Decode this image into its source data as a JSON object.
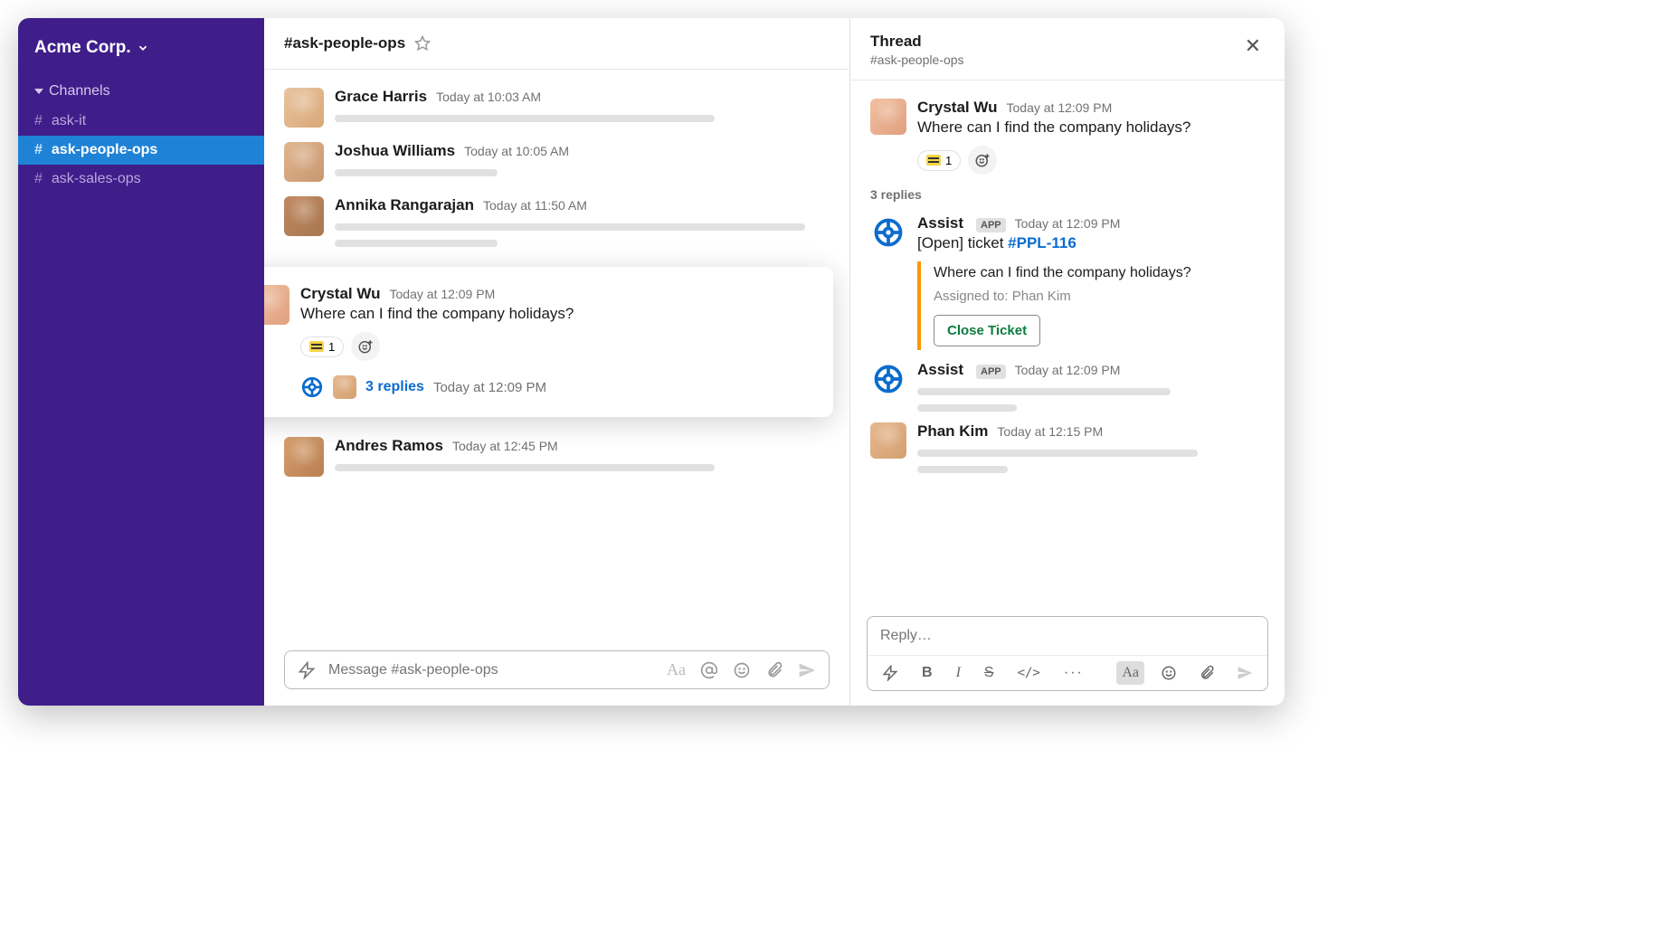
{
  "workspace": {
    "name": "Acme Corp."
  },
  "sidebar": {
    "section": "Channels",
    "channels": [
      {
        "name": "ask-it",
        "active": false
      },
      {
        "name": "ask-people-ops",
        "active": true
      },
      {
        "name": "ask-sales-ops",
        "active": false
      }
    ]
  },
  "channel": {
    "title": "#ask-people-ops",
    "composer_placeholder": "Message #ask-people-ops"
  },
  "messages": [
    {
      "name": "Grace Harris",
      "time": "Today at 10:03 AM"
    },
    {
      "name": "Joshua Williams",
      "time": "Today at 10:05 AM"
    },
    {
      "name": "Annika Rangarajan",
      "time": "Today at 11:50 AM"
    }
  ],
  "highlighted": {
    "name": "Crystal Wu",
    "time": "Today at 12:09 PM",
    "text": "Where can I find the company holidays?",
    "reaction_count": "1",
    "replies_label": "3 replies",
    "replies_time": "Today at 12:09 PM"
  },
  "after_message": {
    "name": "Andres Ramos",
    "time": "Today at 12:45 PM"
  },
  "thread": {
    "title": "Thread",
    "subtitle": "#ask-people-ops",
    "root": {
      "name": "Crystal Wu",
      "time": "Today at 12:09 PM",
      "text": "Where can I find the company holidays?",
      "reaction_count": "1"
    },
    "replies_count": "3 replies",
    "assist1": {
      "name": "Assist",
      "badge": "APP",
      "time": "Today at 12:09 PM",
      "prefix": "[Open]  ticket ",
      "ticket": "#PPL-116",
      "quote": "Where can I find the company holidays?",
      "assigned": "Assigned to: Phan Kim",
      "button": "Close Ticket"
    },
    "assist2": {
      "name": "Assist",
      "badge": "APP",
      "time": "Today at 12:09 PM"
    },
    "phan": {
      "name": "Phan Kim",
      "time": "Today at 12:15 PM"
    },
    "composer_placeholder": "Reply…",
    "toolbar": {
      "bold": "B",
      "italic": "I",
      "strike": "S",
      "code": "</>",
      "more": "···",
      "aa": "Aa"
    }
  }
}
